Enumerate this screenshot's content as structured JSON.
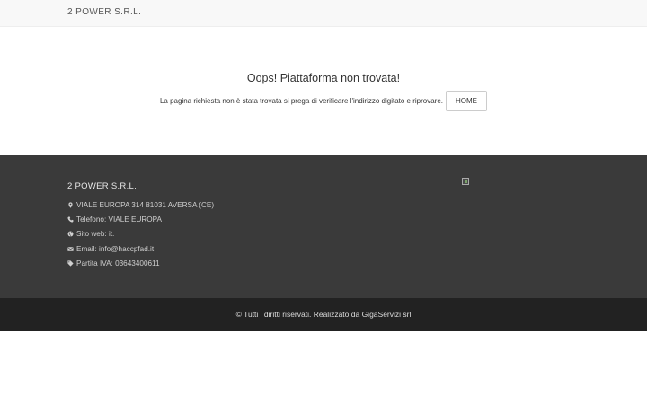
{
  "header": {
    "brand": "2 POWER S.R.L."
  },
  "error": {
    "title": "Oops! Piattaforma non trovata!",
    "message": "La pagina richiesta non è stata trovata si prega di verificare l'indirizzo digitato e riprovare.",
    "home_label": "HOME"
  },
  "footer": {
    "title": "2 POWER S.R.L.",
    "address": "VIALE EUROPA 314 81031 AVERSA (CE)",
    "phone": "Telefono: VIALE EUROPA",
    "website": "Sito web: it.",
    "email": "Email: info@haccpfad.it",
    "vat": "Partita IVA: 03643400611",
    "icons": [
      "map-marker-icon",
      "phone-icon",
      "globe-icon",
      "envelope-icon",
      "tag-icon"
    ]
  },
  "bottom": {
    "copyright": "© Tutti i diritti riservati. Realizzato da GigaServizi srl"
  }
}
